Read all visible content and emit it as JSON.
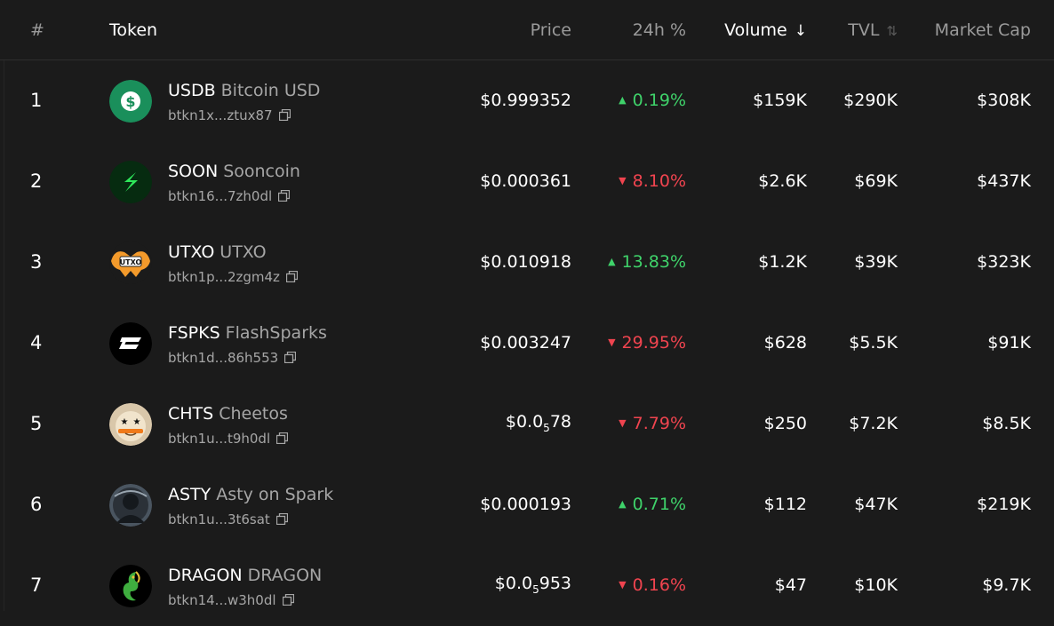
{
  "header": {
    "rank": "#",
    "token": "Token",
    "price": "Price",
    "change": "24h %",
    "volume": "Volume",
    "volume_sort_icon": "arrow-down-icon",
    "tvl": "TVL",
    "tvl_sort_icon": "sort-icon",
    "market_cap": "Market Cap"
  },
  "colors": {
    "background": "#1b1b1b",
    "up": "#3fd26a",
    "down": "#f0444f",
    "muted_text": "#a6a6a6"
  },
  "rows": [
    {
      "rank": "1",
      "symbol": "USDB",
      "name": "Bitcoin USD",
      "address": "btkn1x...ztux87",
      "price": "$0.999352",
      "change": "0.19%",
      "direction": "up",
      "volume": "$159K",
      "tvl": "$290K",
      "market_cap": "$308K",
      "icon": "usdb-logo-icon"
    },
    {
      "rank": "2",
      "symbol": "SOON",
      "name": "Sooncoin",
      "address": "btkn16...7zh0dl",
      "price": "$0.000361",
      "change": "8.10%",
      "direction": "down",
      "volume": "$2.6K",
      "tvl": "$69K",
      "market_cap": "$437K",
      "icon": "soon-logo-icon"
    },
    {
      "rank": "3",
      "symbol": "UTXO",
      "name": "UTXO",
      "address": "btkn1p...2zgm4z",
      "price": "$0.010918",
      "change": "13.83%",
      "direction": "up",
      "volume": "$1.2K",
      "tvl": "$39K",
      "market_cap": "$323K",
      "icon": "utxo-logo-icon",
      "logo_text": "UTXO"
    },
    {
      "rank": "4",
      "symbol": "FSPKS",
      "name": "FlashSparks",
      "address": "btkn1d...86h553",
      "price": "$0.003247",
      "change": "29.95%",
      "direction": "down",
      "volume": "$628",
      "tvl": "$5.5K",
      "market_cap": "$91K",
      "icon": "fspks-logo-icon"
    },
    {
      "rank": "5",
      "symbol": "CHTS",
      "name": "Cheetos",
      "address": "btkn1u...t9h0dl",
      "price_main": "$0.0",
      "price_sub": "5",
      "price_tail": "78",
      "change": "7.79%",
      "direction": "down",
      "volume": "$250",
      "tvl": "$7.2K",
      "market_cap": "$8.5K",
      "icon": "chts-avatar-icon"
    },
    {
      "rank": "6",
      "symbol": "ASTY",
      "name": "Asty on Spark",
      "address": "btkn1u...3t6sat",
      "price": "$0.000193",
      "change": "0.71%",
      "direction": "up",
      "volume": "$112",
      "tvl": "$47K",
      "market_cap": "$219K",
      "icon": "asty-avatar-icon"
    },
    {
      "rank": "7",
      "symbol": "DRAGON",
      "name": "DRAGON",
      "address": "btkn14...w3h0dl",
      "price_main": "$0.0",
      "price_sub": "5",
      "price_tail": "953",
      "change": "0.16%",
      "direction": "down",
      "volume": "$47",
      "tvl": "$10K",
      "market_cap": "$9.7K",
      "icon": "dragon-logo-icon"
    }
  ]
}
